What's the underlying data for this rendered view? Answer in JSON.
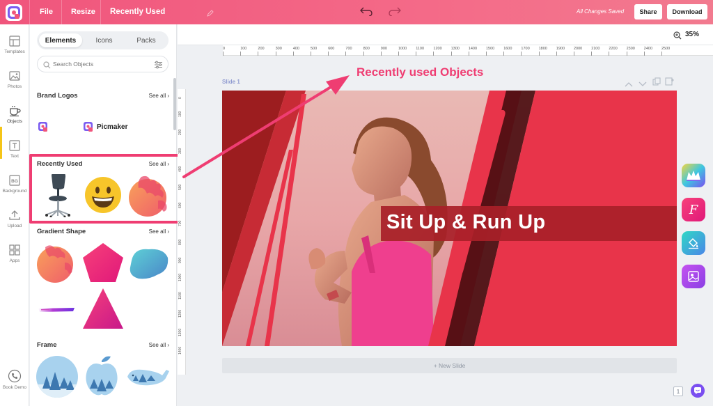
{
  "topbar": {
    "file_label": "File",
    "resize_label": "Resize",
    "doc_title": "Recently Used",
    "saved_status": "All Changes Saved",
    "share_label": "Share",
    "download_label": "Download",
    "brand_color": "#f0557c"
  },
  "rail": {
    "items": [
      {
        "label": "Templates",
        "icon": "templates-icon"
      },
      {
        "label": "Photos",
        "icon": "photo-icon"
      },
      {
        "label": "Objects",
        "icon": "coffee-cup-icon"
      },
      {
        "label": "Text",
        "icon": "text-icon"
      },
      {
        "label": "Background",
        "icon": "bg-icon"
      },
      {
        "label": "Upload",
        "icon": "upload-icon"
      },
      {
        "label": "Apps",
        "icon": "apps-icon"
      }
    ],
    "active_index": 2,
    "book_demo_label": "Book Demo"
  },
  "panel": {
    "tabs": [
      "Elements",
      "Icons",
      "Packs"
    ],
    "active_tab": "Elements",
    "search_placeholder": "Search Objects",
    "see_all_label": "See all",
    "sections": [
      {
        "title": "Brand Logos"
      },
      {
        "title": "Recently Used"
      },
      {
        "title": "Gradient Shape"
      },
      {
        "title": "Frame"
      }
    ],
    "brand_logo_text": "Picmaker"
  },
  "canvas": {
    "zoom": "35%",
    "ruler_top": [
      "0",
      "100",
      "200",
      "300",
      "400",
      "500",
      "600",
      "700",
      "800",
      "900",
      "1000",
      "1100",
      "1200",
      "1300",
      "1400",
      "1500",
      "1600",
      "1700",
      "1800",
      "1900",
      "2000",
      "2100",
      "2200",
      "2300",
      "2400",
      "2500"
    ],
    "ruler_left": [
      "0",
      "100",
      "200",
      "300",
      "400",
      "500",
      "600",
      "700",
      "800",
      "900",
      "1000",
      "1100",
      "1200",
      "1300",
      "1400"
    ],
    "slide_label": "Slide 1",
    "slide_headline": "Sit Up & Run Up",
    "new_slide_label": "+ New Slide",
    "page_number": "1",
    "accent_red": "#e8344a",
    "dark_red": "#9c1d1f"
  },
  "annotation": {
    "text": "Recently used Objects",
    "color": "#ef3d72"
  }
}
